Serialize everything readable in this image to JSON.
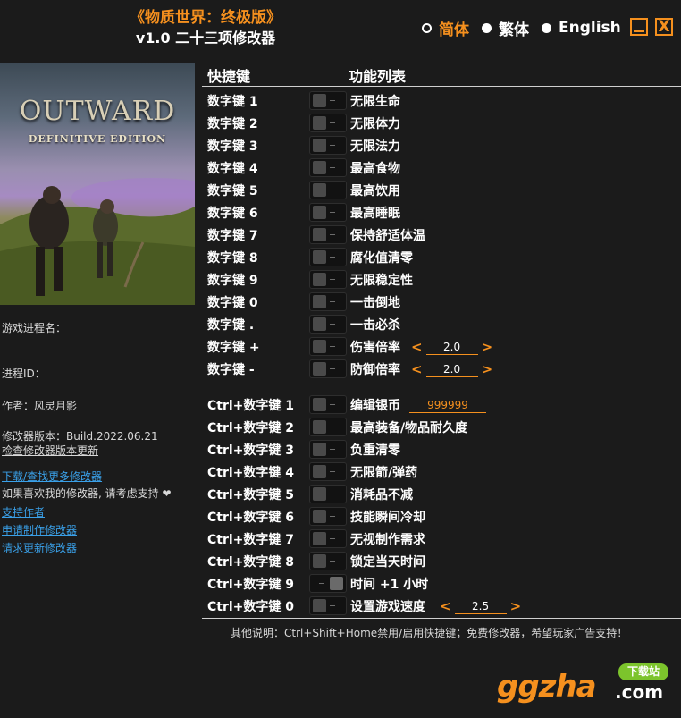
{
  "header": {
    "title": "《物质世界：终极版》",
    "subtitle": "v1.0 二十三项修改器"
  },
  "languages": [
    {
      "label": "简体",
      "selected": true
    },
    {
      "label": "繁体",
      "selected": false
    },
    {
      "label": "English",
      "selected": false
    }
  ],
  "window": {
    "minimize_icon": "minimize-icon",
    "close_label": "X"
  },
  "cover": {
    "title": "OUTWARD",
    "subtitle": "DEFINITIVE EDITION"
  },
  "info": {
    "process_name_label": "游戏进程名：",
    "process_id_label": "进程ID：",
    "author": "作者：风灵月影",
    "version": "修改器版本：Build.2022.06.21",
    "check_update": "检查修改器版本更新"
  },
  "links": {
    "download_more": "下载/查找更多修改器",
    "support_text": "如果喜欢我的修改器, 请考虑支持 ❤",
    "support_author": "支持作者",
    "request_trainer": "申请制作修改器",
    "request_update": "请求更新修改器"
  },
  "columns": {
    "hotkey": "快捷键",
    "features": "功能列表"
  },
  "group1": [
    {
      "key": "数字键 1",
      "name": "无限生命",
      "on": false
    },
    {
      "key": "数字键 2",
      "name": "无限体力",
      "on": false
    },
    {
      "key": "数字键 3",
      "name": "无限法力",
      "on": false
    },
    {
      "key": "数字键 4",
      "name": "最高食物",
      "on": false
    },
    {
      "key": "数字键 5",
      "name": "最高饮用",
      "on": false
    },
    {
      "key": "数字键 6",
      "name": "最高睡眠",
      "on": false
    },
    {
      "key": "数字键 7",
      "name": "保持舒适体温",
      "on": false
    },
    {
      "key": "数字键 8",
      "name": "腐化值清零",
      "on": false
    },
    {
      "key": "数字键 9",
      "name": "无限稳定性",
      "on": false
    },
    {
      "key": "数字键 0",
      "name": "一击倒地",
      "on": false
    },
    {
      "key": "数字键 .",
      "name": "一击必杀",
      "on": false
    },
    {
      "key": "数字键 +",
      "name": "伤害倍率",
      "on": false,
      "value": "2.0"
    },
    {
      "key": "数字键 -",
      "name": "防御倍率",
      "on": false,
      "value": "2.0"
    }
  ],
  "group2": [
    {
      "key": "Ctrl+数字键 1",
      "name": "编辑银币",
      "on": false,
      "money": "999999"
    },
    {
      "key": "Ctrl+数字键 2",
      "name": "最高装备/物品耐久度",
      "on": false
    },
    {
      "key": "Ctrl+数字键 3",
      "name": "负重清零",
      "on": false
    },
    {
      "key": "Ctrl+数字键 4",
      "name": "无限箭/弹药",
      "on": false
    },
    {
      "key": "Ctrl+数字键 5",
      "name": "消耗品不减",
      "on": false
    },
    {
      "key": "Ctrl+数字键 6",
      "name": "技能瞬间冷却",
      "on": false
    },
    {
      "key": "Ctrl+数字键 7",
      "name": "无视制作需求",
      "on": false
    },
    {
      "key": "Ctrl+数字键 8",
      "name": "锁定当天时间",
      "on": false
    },
    {
      "key": "Ctrl+数字键 9",
      "name": "时间 +1 小时",
      "on": true
    },
    {
      "key": "Ctrl+数字键 0",
      "name": "设置游戏速度",
      "on": false,
      "value": "2.5"
    }
  ],
  "stepper": {
    "left": "<",
    "right": ">"
  },
  "footer": {
    "note": "其他说明：Ctrl+Shift+Home禁用/启用快捷键；免费修改器，希望玩家广告支持！"
  },
  "watermark": {
    "brand": "ggzha",
    "domain": ".com",
    "badge": "下载站"
  },
  "colors": {
    "accent": "#f5901e",
    "link": "#3aa0e8",
    "background": "#1b1b1b"
  }
}
